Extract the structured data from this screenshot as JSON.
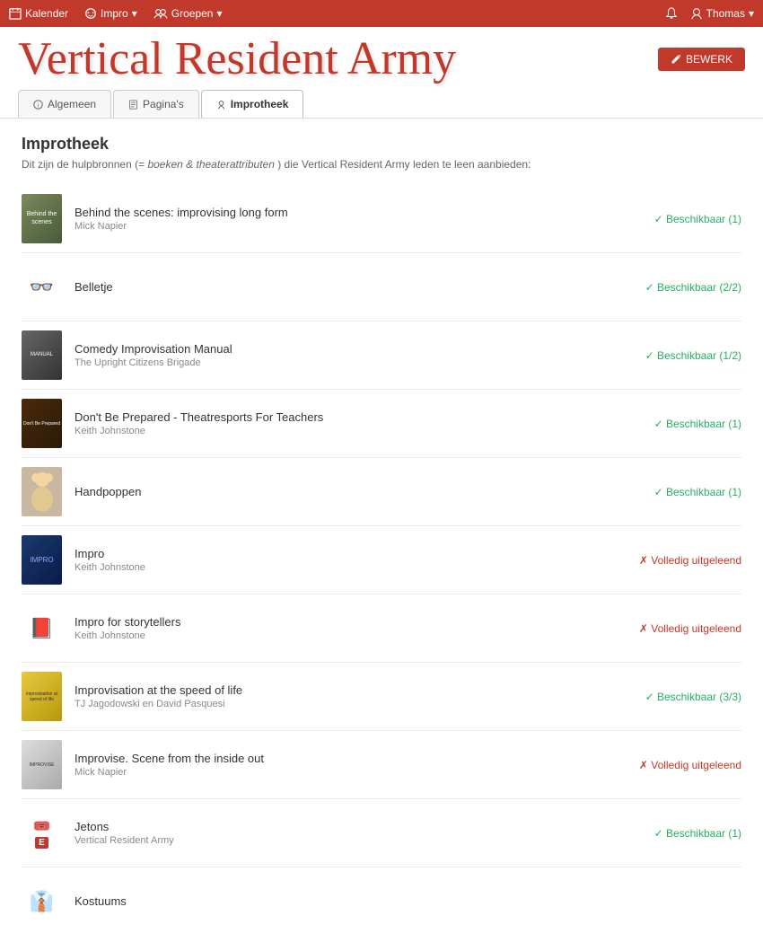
{
  "nav": {
    "kalender": "Kalender",
    "impro": "Impro",
    "groepen": "Groepen",
    "user": "Thomas",
    "bewerk": "BEWERK"
  },
  "tabs": [
    {
      "id": "algemeen",
      "label": "Algemeen",
      "active": false
    },
    {
      "id": "paginas",
      "label": "Pagina's",
      "active": false
    },
    {
      "id": "improtheek",
      "label": "Improtheek",
      "active": true
    }
  ],
  "section": {
    "title": "Improtheek",
    "subtitle_pre": "Dit zijn de hulpbronnen (=",
    "subtitle_em": "boeken & theaterattributen",
    "subtitle_post": ") die Vertical Resident Army leden te leen aanbieden:"
  },
  "logo": "Vertical Resident Army",
  "items": [
    {
      "id": "behind",
      "title": "Behind the scenes: improvising long form",
      "author": "Mick Napier",
      "status": "Beschikbaar (1)",
      "available": true,
      "cover_class": "cover-behind",
      "has_thumb": true
    },
    {
      "id": "belletje",
      "title": "Belletje",
      "author": "",
      "status": "Beschikbaar (2/2)",
      "available": true,
      "has_thumb": false,
      "icon": "👓"
    },
    {
      "id": "comedy",
      "title": "Comedy Improvisation Manual",
      "author": "The Upright Citizens Brigade",
      "status": "Beschikbaar (1/2)",
      "available": true,
      "cover_class": "cover-comedy",
      "has_thumb": true
    },
    {
      "id": "dontbe",
      "title": "Don't Be Prepared - Theatresports For Teachers",
      "author": "Keith Johnstone",
      "status": "Beschikbaar (1)",
      "available": true,
      "cover_class": "cover-dontbe",
      "has_thumb": true
    },
    {
      "id": "handpoppen",
      "title": "Handpoppen",
      "author": "",
      "status": "Beschikbaar (1)",
      "available": true,
      "cover_class": "cover-handpoppen",
      "has_thumb": true
    },
    {
      "id": "impro",
      "title": "Impro",
      "author": "Keith Johnstone",
      "status": "Volledig uitgeleend",
      "available": false,
      "cover_class": "cover-impro",
      "has_thumb": true
    },
    {
      "id": "impro-story",
      "title": "Impro for storytellers",
      "author": "Keith Johnstone",
      "status": "Volledig uitgeleend",
      "available": false,
      "has_thumb": false,
      "icon": "📕"
    },
    {
      "id": "improvisation",
      "title": "Improvisation at the speed of life",
      "author": "TJ Jagodowski en David Pasquesi",
      "status": "Beschikbaar (3/3)",
      "available": true,
      "cover_class": "cover-improvisation",
      "has_thumb": true
    },
    {
      "id": "improvise",
      "title": "Improvise. Scene from the inside out",
      "author": "Mick Napier",
      "status": "Volledig uitgeleend",
      "available": false,
      "cover_class": "cover-improvise",
      "has_thumb": true
    },
    {
      "id": "jetons",
      "title": "Jetons",
      "author": "Vertical Resident Army",
      "status": "Beschikbaar (1)",
      "available": true,
      "has_thumb": false,
      "icon": "🎟️",
      "has_red_e": true
    },
    {
      "id": "kostuums",
      "title": "Kostuums",
      "author": "",
      "status": "",
      "available": null,
      "has_thumb": false,
      "icon": ""
    }
  ]
}
